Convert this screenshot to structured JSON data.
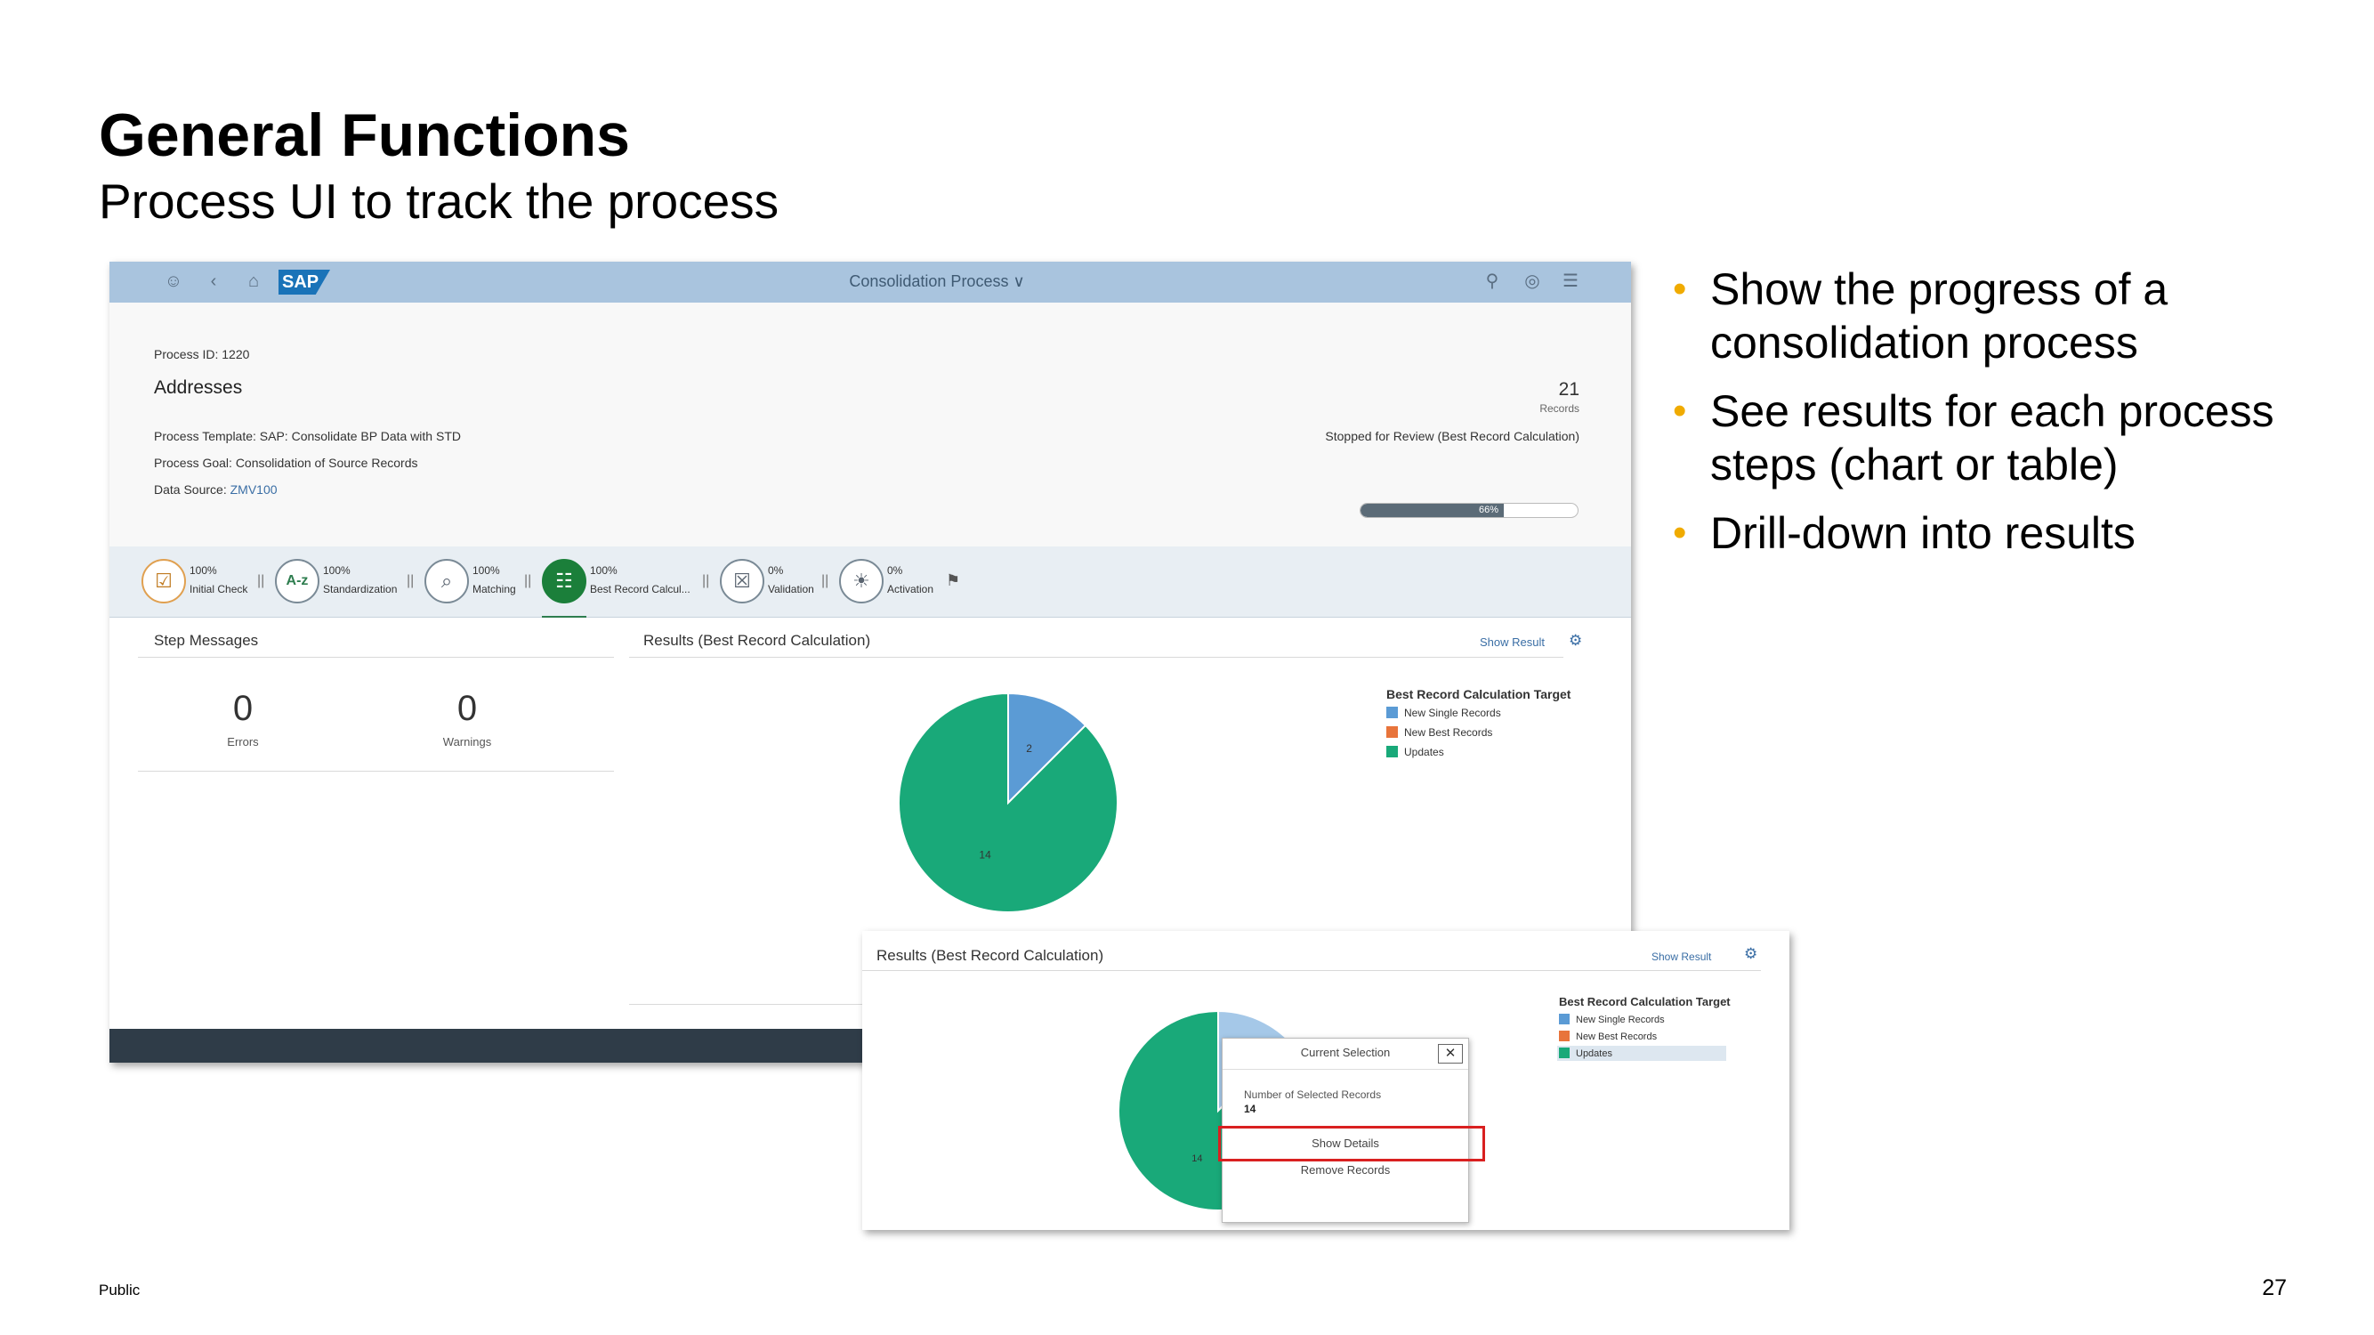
{
  "slide": {
    "title": "General Functions",
    "subtitle": "Process UI to track the process",
    "classification": "Public",
    "page_number": "27",
    "bullets": [
      "Show the progress of a consolidation process",
      "See results for each process steps (chart or table)",
      "Drill-down into results"
    ],
    "bullet_color": "#f0ab00"
  },
  "app": {
    "shell": {
      "title": "Consolidation Process ∨",
      "logo": "SAP",
      "left_icons": [
        "user-icon",
        "back-icon",
        "home-icon"
      ],
      "right_icons": [
        "search-icon",
        "globe-icon",
        "menu-icon"
      ],
      "bar_color": "#a9c4de"
    },
    "header": {
      "process_id": "Process ID: 1220",
      "object": "Addresses",
      "template": "Process Template: SAP: Consolidate BP Data with STD",
      "goal": "Process Goal: Consolidation of Source Records",
      "data_source_label": "Data Source:",
      "data_source_value": "ZMV100",
      "records_count": "21",
      "records_label": "Records",
      "status": "Stopped for Review (Best Record Calculation)",
      "progress_pct": 66,
      "progress_label": "66%"
    },
    "steps": [
      {
        "pct": "100%",
        "name": "Initial Check",
        "icon": "checklist-icon",
        "active": false
      },
      {
        "pct": "100%",
        "name": "Standardization",
        "icon": "a-z-icon",
        "active": false
      },
      {
        "pct": "100%",
        "name": "Matching",
        "icon": "magnifier-icon",
        "active": false
      },
      {
        "pct": "100%",
        "name": "Best Record Calcul...",
        "icon": "clipboard-icon",
        "active": true
      },
      {
        "pct": "0%",
        "name": "Validation",
        "icon": "validation-icon",
        "active": false
      },
      {
        "pct": "0%",
        "name": "Activation",
        "icon": "lightbulb-icon",
        "active": false
      }
    ],
    "step_messages": {
      "title": "Step Messages",
      "errors": "0",
      "errors_label": "Errors",
      "warnings": "0",
      "warnings_label": "Warnings"
    },
    "results": {
      "title": "Results (Best Record Calculation)",
      "show_result": "Show Result",
      "legend_title": "Best Record Calculation Target",
      "legend": [
        {
          "label": "New Single Records",
          "color": "#5b9bd5"
        },
        {
          "label": "New Best Records",
          "color": "#e8743b"
        },
        {
          "label": "Updates",
          "color": "#19a979"
        }
      ]
    }
  },
  "zoom": {
    "title": "Results (Best Record Calculation)",
    "show_result": "Show Result",
    "legend_title": "Best Record Calculation Target",
    "popup": {
      "header": "Current Selection",
      "label": "Number of Selected Records",
      "value": "14",
      "show_details": "Show Details",
      "remove_records": "Remove Records"
    },
    "slice_label": "14"
  },
  "chart_data": {
    "type": "pie",
    "title": "Results (Best Record Calculation)",
    "legend_title": "Best Record Calculation Target",
    "categories": [
      "New Single Records",
      "New Best Records",
      "Updates"
    ],
    "values": [
      2,
      0,
      14
    ],
    "colors": [
      "#5b9bd5",
      "#e8743b",
      "#19a979"
    ],
    "data_labels": [
      "2",
      "",
      "14"
    ],
    "legend_position": "top-right"
  }
}
